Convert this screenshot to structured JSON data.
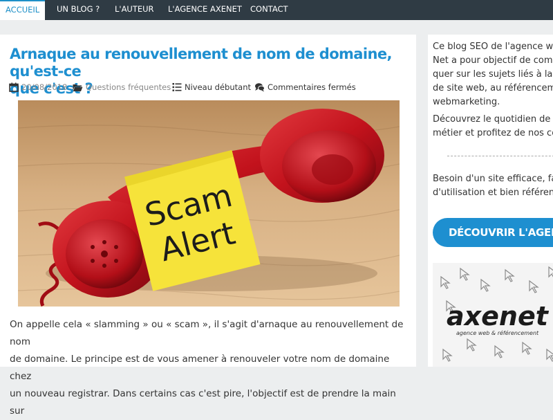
{
  "nav": {
    "items": [
      {
        "label": "ACCUEIL",
        "active": true
      },
      {
        "label": "UN BLOG ?"
      },
      {
        "label": "L'AUTEUR"
      },
      {
        "label": "L'AGENCE AXENET"
      },
      {
        "label": "CONTACT"
      }
    ]
  },
  "article": {
    "title_line1": "Arnaque au renouvellement de nom de domaine, qu'est-ce",
    "title_line2": "que c'est ?",
    "meta": {
      "date": "20/08/2018",
      "category": "Questions fréquentes",
      "level": "Niveau débutant",
      "comments": "Commentaires fermés"
    },
    "image": {
      "note_line1": "Scam",
      "note_line2": "Alert"
    },
    "body_line1": "On appelle cela « slamming » ou « scam », il s'agit d'arnaque au renouvellement de nom",
    "body_line2": "de domaine. Le principe est de vous amener à renouveler votre nom de domaine chez",
    "body_line3": "un nouveau registrar. Dans certains cas c'est pire, l'objectif est de prendre la main sur"
  },
  "sidebar": {
    "intro_lines": [
      "Ce blog SEO de l'agence we",
      "Net a pour objectif de com",
      "quer sur les sujets liés à la",
      "de site web, au référencem",
      "webmarketing."
    ],
    "daily_lines": [
      "Découvrez le quotidien de",
      "métier et profitez de nos co"
    ],
    "offer_lines": [
      "Besoin d'un site efficace, fa",
      "d'utilisation et bien référen"
    ],
    "cta_label": "DÉCOUVRIR L'AGENCE",
    "promo": {
      "logo_text": "axenet",
      "tagline": "agence web & référencement"
    }
  },
  "colors": {
    "accent": "#1e8fd0",
    "nav_bg": "#2f3b44",
    "page_bg": "#eceeef",
    "phone_red": "#c2121c",
    "note_yellow": "#f6e33a"
  }
}
